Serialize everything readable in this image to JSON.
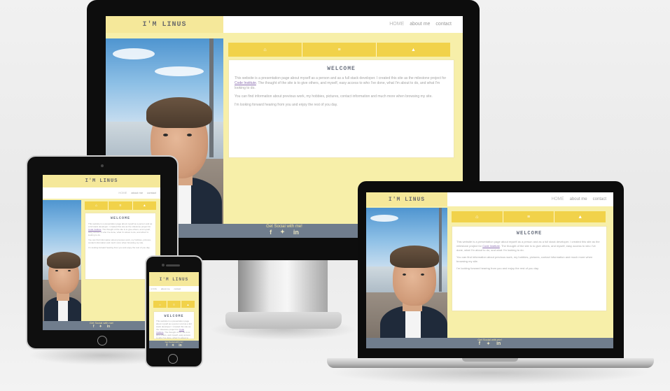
{
  "site": {
    "logo": "I'M LINUS",
    "nav": [
      "HOME",
      "about me",
      "contact"
    ],
    "icons": [
      "home-icon",
      "bars-icon",
      "triangle-icon"
    ],
    "icon_glyphs": [
      "⌂",
      "≡",
      "▲"
    ],
    "welcome_title": "WELCOME",
    "para1_pre": "This website is a presentation page about myself as a person and as a full stack developer. I created this site as the milestone project for ",
    "para1_link": "Code Institute",
    "para1_post": ". The thought of the site is to give others, and myself, easy access to who I've done, what I'm about to do, and what I'm looking to do.",
    "para2": "You can find information about previous work, my hobbies, pictures, contact information and much more when browsing my site.",
    "para3": "I'm looking forward hearing from you and enjoy the rest of you day.",
    "footer_text": "Get Social with me!",
    "social_icons": [
      "facebook-icon",
      "twitter-icon",
      "linkedin-icon"
    ],
    "social_glyphs": [
      "f",
      "🐦",
      "in"
    ]
  },
  "colors": {
    "accent_yellow": "#f1d24a",
    "logo_bg": "#f5e89a",
    "page_bg": "#f7efa9",
    "footer_bg": "#707d8d"
  }
}
